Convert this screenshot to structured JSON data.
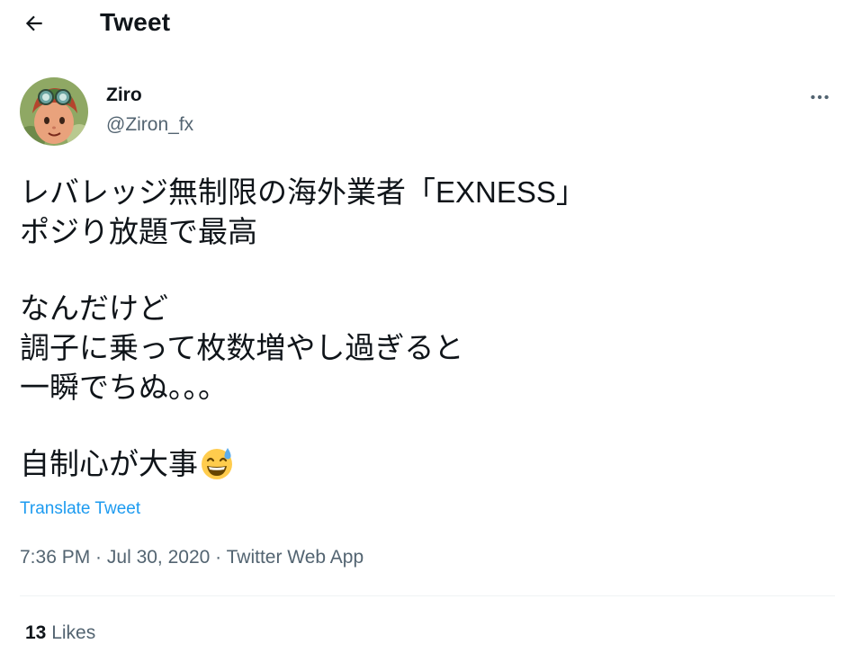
{
  "header": {
    "title": "Tweet",
    "back_icon": "arrow-left-icon"
  },
  "author": {
    "name": "Ziro",
    "handle": "@Ziron_fx",
    "avatar_icon": "avatar-cartoon-goggles"
  },
  "tweet": {
    "lines": [
      "レバレッジ無制限の海外業者「EXNESS」",
      "ポジり放題で最高",
      "",
      "なんだけど",
      "調子に乗って枚数増やし過ぎると",
      "一瞬でちぬ。。。",
      "",
      "自制心が大事"
    ],
    "emoji": "sweat-smile-emoji",
    "translate_label": "Translate Tweet"
  },
  "meta": {
    "time": "7:36 PM",
    "separator": " · ",
    "date": "Jul 30, 2020",
    "source": "Twitter Web App"
  },
  "stats": {
    "likes_count": "13",
    "likes_label": "Likes"
  },
  "colors": {
    "text": "#0f1419",
    "secondary": "#536471",
    "link": "#1d9bf0",
    "divider": "#eff3f4"
  }
}
